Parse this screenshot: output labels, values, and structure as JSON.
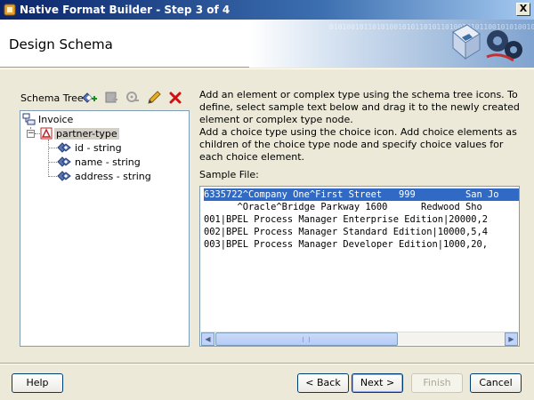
{
  "window": {
    "title": "Native Format Builder - Step 3 of 4",
    "close_label": "X"
  },
  "header": {
    "page_title": "Design Schema",
    "banner_binary": "01010010110101001010110101101001010110010101001011010101001011101010011010100101101010010111010100110101001011010100101110101"
  },
  "tree": {
    "label": "Schema Tree",
    "tools": [
      "add-element-icon",
      "add-complex-type-icon",
      "add-choice-icon",
      "edit-icon",
      "delete-icon"
    ],
    "nodes": {
      "root": "Invoice",
      "partner": "partner-type",
      "id": "id - string",
      "name": "name - string",
      "address": "address - string"
    }
  },
  "description": {
    "line1": "Add an element or complex type using the schema tree icons. To define, select sample text below and drag it to the newly created element or complex type node.",
    "line2": "Add a choice type using the choice icon. Add choice elements as children of the choice type node and specify choice values for each choice element."
  },
  "sample": {
    "label": "Sample File:",
    "lines": [
      "6335722^Company One^First Street   999         San Jo",
      "      ^Oracle^Bridge Parkway 1600      Redwood Sho",
      "001|BPEL Process Manager Enterprise Edition|20000,2",
      "002|BPEL Process Manager Standard Edition|10000,5,4",
      "003|BPEL Process Manager Developer Edition|1000,20,"
    ]
  },
  "buttons": {
    "help": "Help",
    "back": "< Back",
    "next": "Next >",
    "finish": "Finish",
    "cancel": "Cancel"
  },
  "colors": {
    "selection": "#316ac5",
    "titlebar": "#0a246a",
    "delete": "#d01010"
  }
}
